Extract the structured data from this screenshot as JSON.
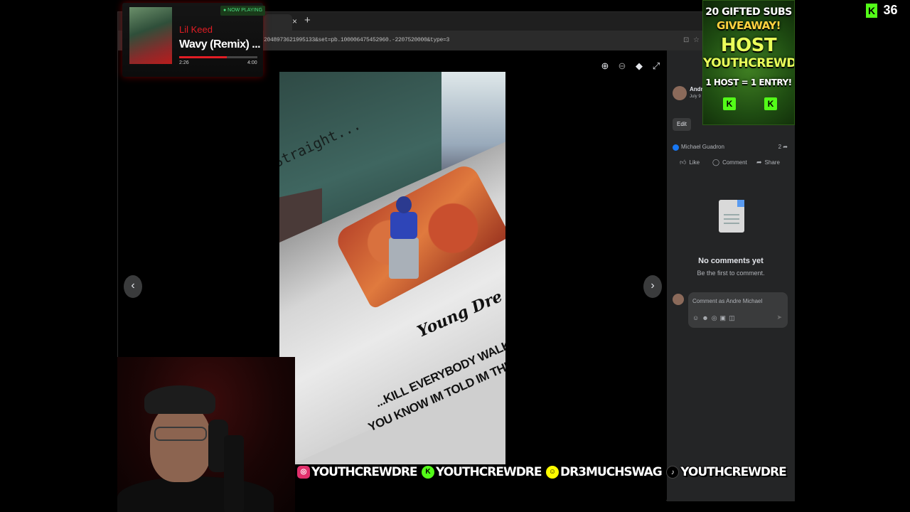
{
  "browser": {
    "url": "2048973621995133&set=pb.100006475452960.-2207520000&type=3"
  },
  "photo": {
    "caption_name": "Young Dre",
    "caption_line1": "...KILL EVERYBODY WALKING",
    "caption_line2": "YOU KNOW IM TOLD IM THE FINEST",
    "graffiti": "Straight..."
  },
  "panel": {
    "author": "Andre",
    "date": "July 9",
    "edit_label": "Edit",
    "reaction_name": "Michael Guadron",
    "share_count": "2",
    "actions": {
      "like": "Like",
      "comment": "Comment",
      "share": "Share"
    },
    "no_comments": "No comments yet",
    "be_first": "Be the first to comment.",
    "comment_placeholder": "Comment as Andre Michael"
  },
  "now_playing": {
    "badge": "● NOW PLAYING",
    "artist": "Lil Keed",
    "title": "Wavy (Remix) ...",
    "elapsed": "2:26",
    "duration": "4:00",
    "progress": 0.61
  },
  "giveaway": {
    "line1": "20 GIFTED SUBS",
    "line2": "GIVEAWAY!",
    "line3": "HOST",
    "line4": "YOUTHCREWDRE",
    "line5": "1 HOST = 1 ENTRY!",
    "badge": "K"
  },
  "viewers": {
    "platform_badge": "K",
    "count": "36"
  },
  "socials": [
    {
      "platform": "instagram",
      "handle": "YOUTHCREWDRE"
    },
    {
      "platform": "kick",
      "handle": "YOUTHCREWDRE"
    },
    {
      "platform": "snapchat",
      "handle": "DR3MUCHSWAG"
    },
    {
      "platform": "tiktok",
      "handle": "YOUTHCREWDRE"
    }
  ],
  "colors": {
    "accent_red": "#e11d24",
    "kick_green": "#53fc18",
    "facebook_blue": "#1877f2"
  }
}
